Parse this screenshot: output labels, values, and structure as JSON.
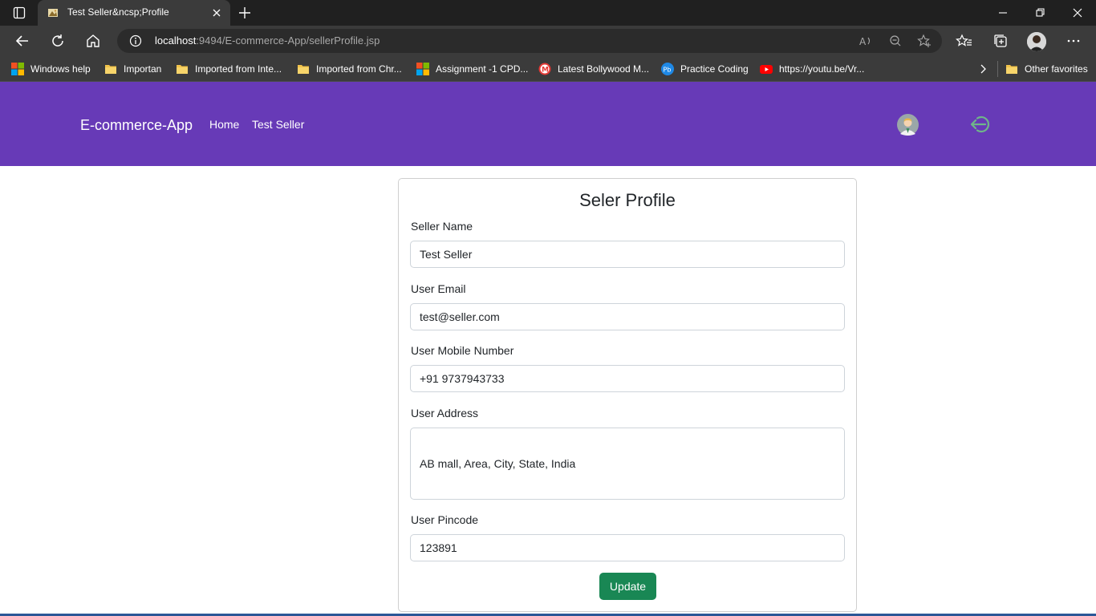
{
  "browser": {
    "tab_title": "Test Seller&ncsp;Profile",
    "url_host": "localhost",
    "url_rest": ":9494/E-commerce-App/sellerProfile.jsp",
    "bookmarks": [
      {
        "label": "Windows help",
        "icon": "windows-logo-icon"
      },
      {
        "label": "Importan",
        "icon": "folder-icon"
      },
      {
        "label": "Imported from Inte...",
        "icon": "folder-icon"
      },
      {
        "label": "Imported from Chr...",
        "icon": "folder-icon"
      },
      {
        "label": "Assignment -1 CPD...",
        "icon": "windows-logo-icon"
      },
      {
        "label": "Latest Bollywood M...",
        "icon": "mx-logo-icon"
      },
      {
        "label": "Practice Coding",
        "icon": "pb-logo-icon"
      },
      {
        "label": "https://youtu.be/Vr...",
        "icon": "youtube-icon"
      }
    ],
    "other_favorites": "Other favorites"
  },
  "site": {
    "brand": "E-commerce-App",
    "nav_links": [
      "Home",
      "Test Seller"
    ],
    "nav_color": "#673ab7"
  },
  "profile": {
    "title": "Seler Profile",
    "fields": {
      "name": {
        "label": "Seller Name",
        "value": "Test Seller"
      },
      "email": {
        "label": "User Email",
        "value": "test@seller.com"
      },
      "mobile": {
        "label": "User Mobile Number",
        "value": "+91 9737943733"
      },
      "address": {
        "label": "User Address",
        "value": "AB mall, Area, City, State, India"
      },
      "pincode": {
        "label": "User Pincode",
        "value": "123891"
      }
    },
    "update_label": "Update",
    "button_color": "#198754"
  }
}
